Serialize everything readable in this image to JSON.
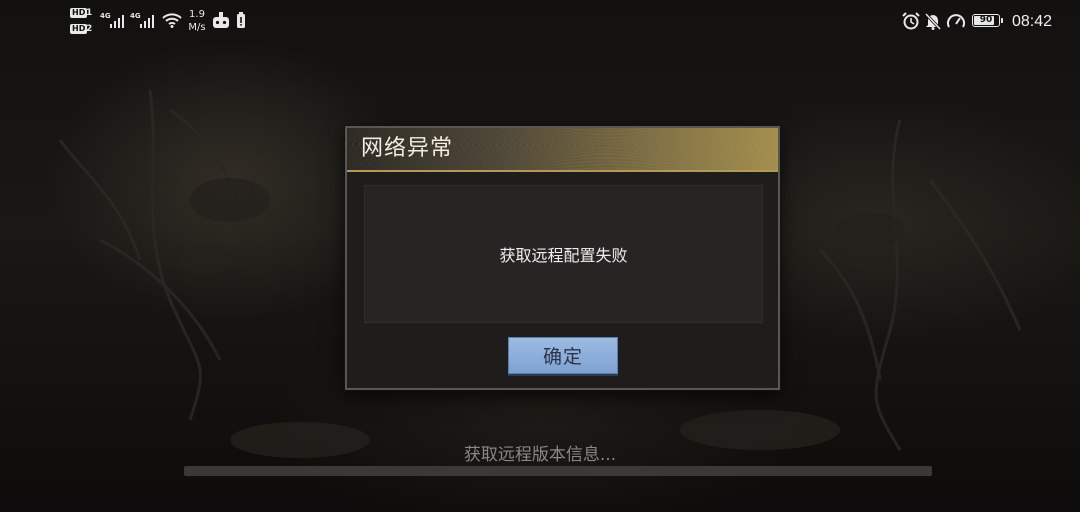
{
  "status_bar": {
    "sim1_badge": "HD",
    "sim1_slot": "1",
    "sim2_badge": "HD",
    "sim2_slot": "2",
    "network1": "4G",
    "network2": "4G",
    "speed_value": "1.9",
    "speed_unit": "M/s",
    "battery_level": "90",
    "time": "08:42",
    "icons_left": [
      "signal-icon",
      "signal-icon",
      "wifi-icon",
      "game-controller-icon",
      "battery-saver-icon"
    ],
    "icons_right": [
      "alarm-clock-icon",
      "bell-off-icon",
      "gauge-icon",
      "battery-icon"
    ]
  },
  "dialog": {
    "title": "网络异常",
    "message": "获取远程配置失败",
    "confirm_label": "确定"
  },
  "loading": {
    "text": "获取远程版本信息...",
    "progress": 0
  },
  "colors": {
    "header_gold": "#a28d4c",
    "button_blue": "#8fb0da",
    "dialog_bg": "#1e1d1c"
  }
}
